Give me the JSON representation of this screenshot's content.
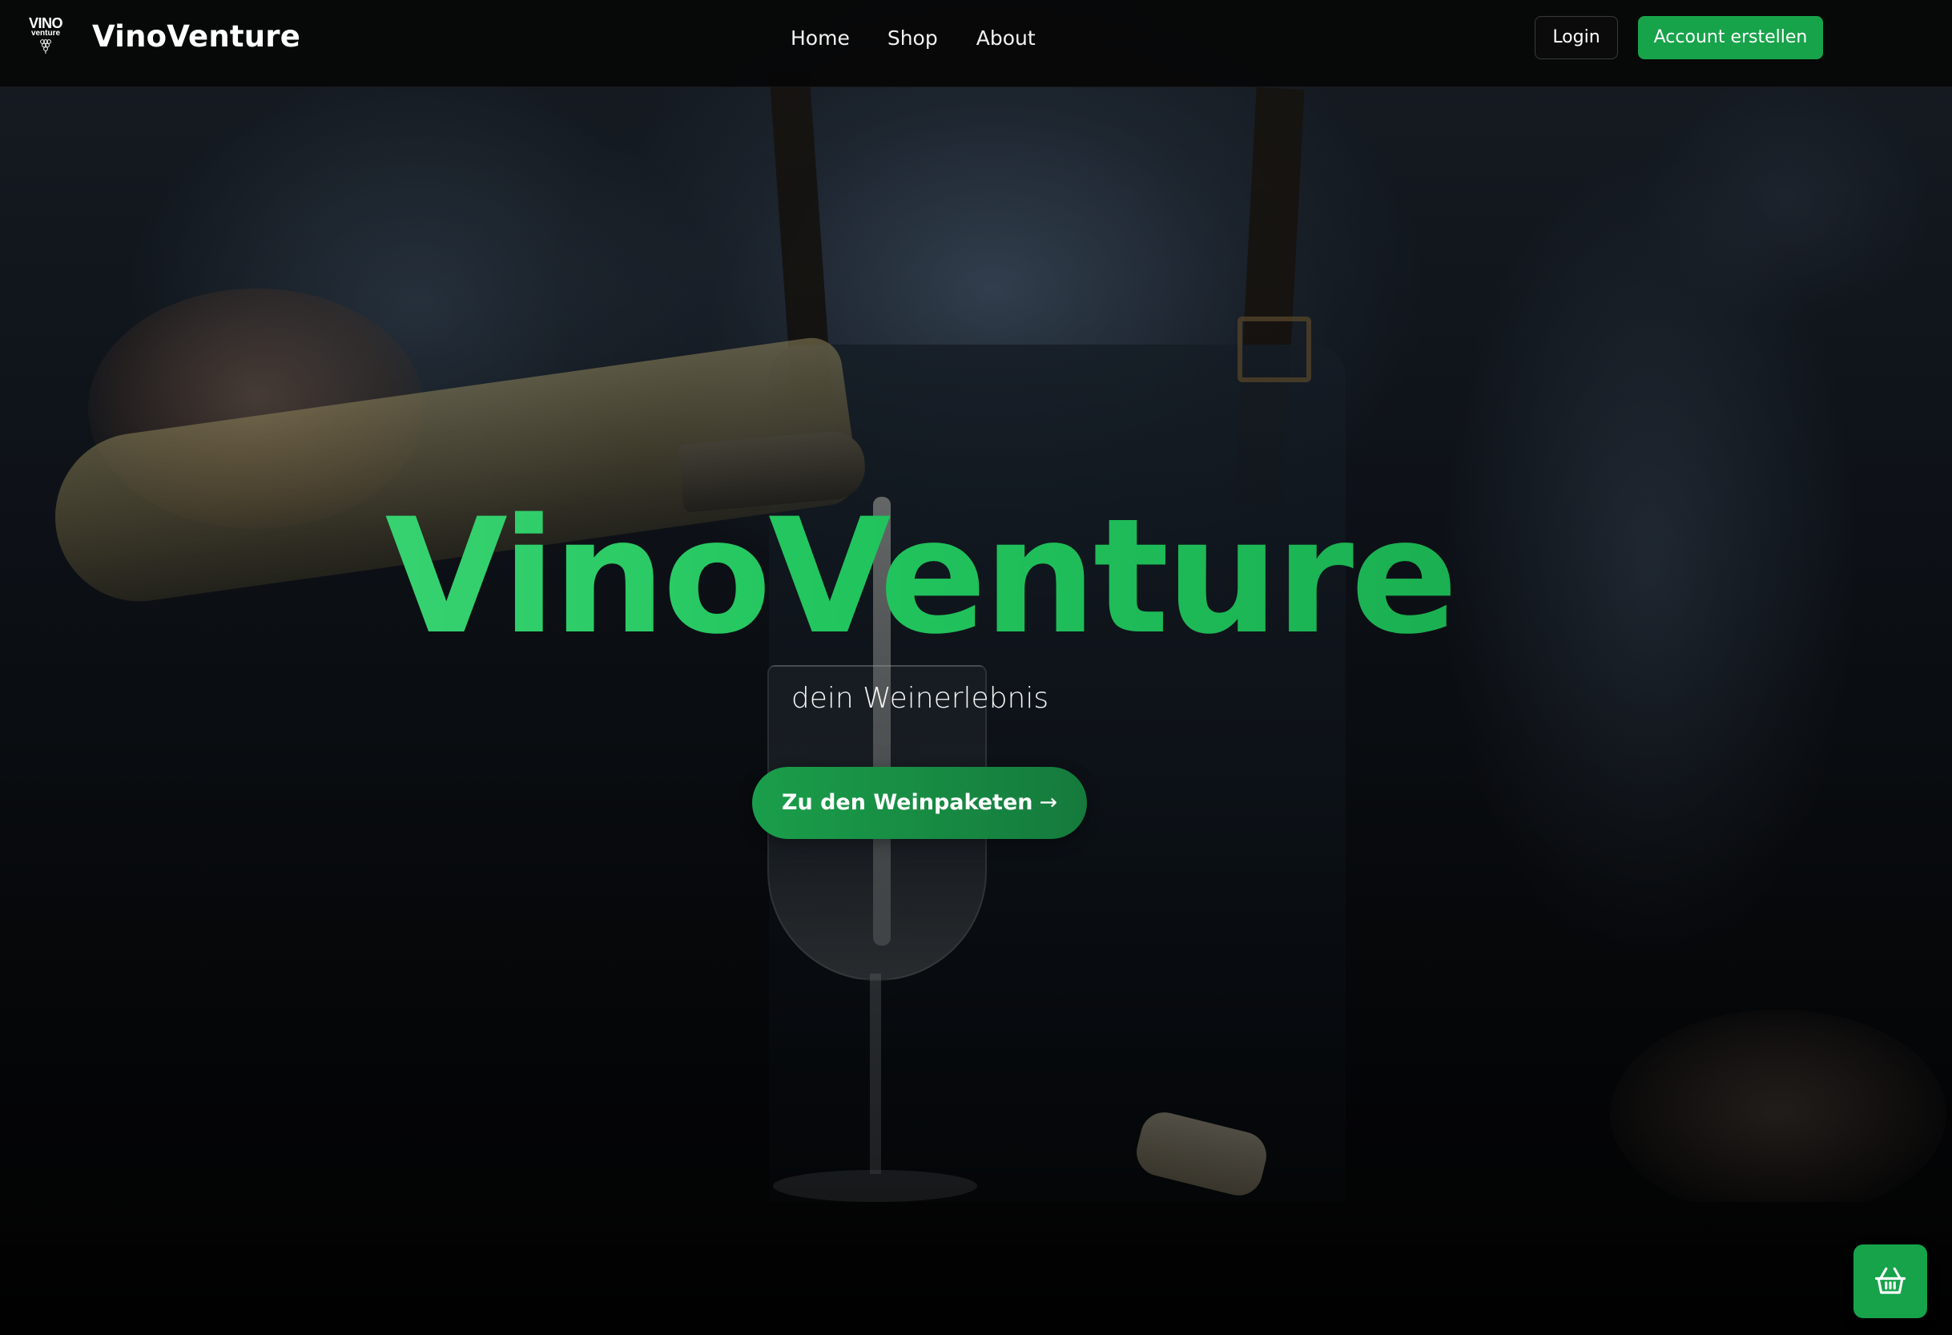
{
  "navbar": {
    "logo": {
      "top": "VINO",
      "sub": "venture",
      "icon": "grape-icon"
    },
    "brand": "VinoVenture",
    "links": [
      {
        "label": "Home"
      },
      {
        "label": "Shop"
      },
      {
        "label": "About"
      }
    ],
    "login_label": "Login",
    "signup_label": "Account erstellen"
  },
  "hero": {
    "title": "VinoVenture",
    "subtitle": "dein Weinerlebnis",
    "cta_label": "Zu den Weinpaketen",
    "cta_arrow": "→"
  },
  "cart": {
    "icon": "shopping-basket-icon"
  },
  "colors": {
    "accent": "#16a34a",
    "accent_light": "#4ade80",
    "navbar_bg": "#060606"
  }
}
